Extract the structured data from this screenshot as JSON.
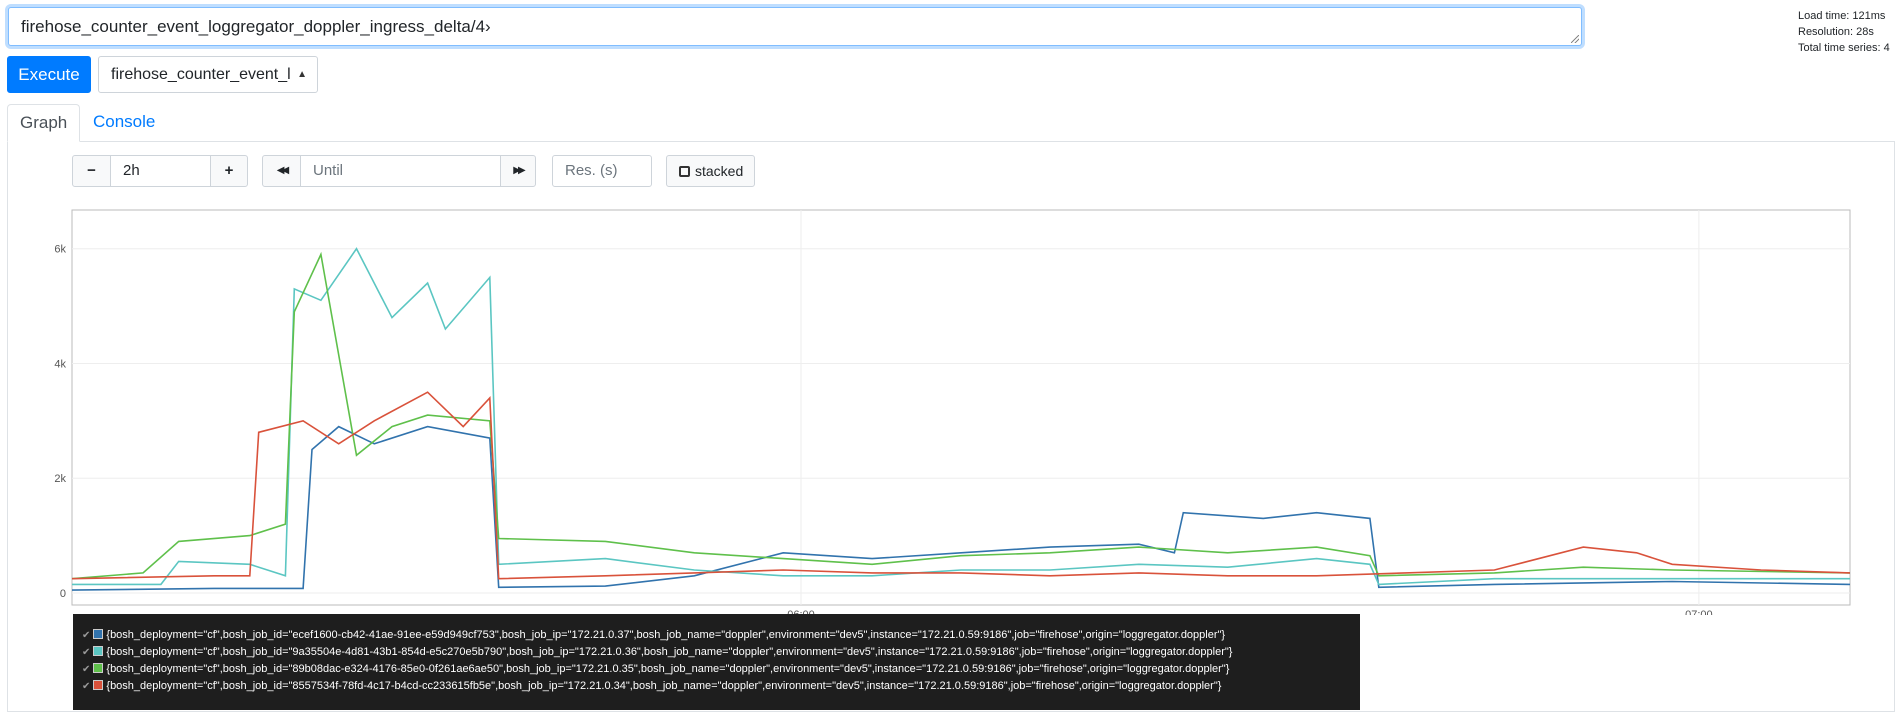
{
  "query": {
    "expression": "firehose_counter_event_loggregator_doppler_ingress_delta/4›",
    "execute_label": "Execute",
    "metric_select_value": "firehose_counter_event_l"
  },
  "stats": {
    "load_time": "Load time: 121ms",
    "resolution": "Resolution: 28s",
    "total_series": "Total time series: 4"
  },
  "tabs": [
    {
      "label": "Graph",
      "active": true
    },
    {
      "label": "Console",
      "active": false
    }
  ],
  "controls": {
    "minus_label": "−",
    "range_value": "2h",
    "plus_label": "+",
    "back_label": "◀◀",
    "until_placeholder": "Until",
    "forward_label": "▶▶",
    "res_placeholder": "Res. (s)",
    "stacked_label": "stacked"
  },
  "chart_data": {
    "type": "line",
    "x_ticks": [
      "06:00",
      "07:00"
    ],
    "y_ticks": [
      "0",
      "2k",
      "4k",
      "6k"
    ],
    "ylim": [
      0,
      6500
    ],
    "grid": true,
    "series": [
      {
        "name": "{bosh_deployment=\"cf\",bosh_job_id=\"ecef1600-cb42-41ae-91ee-e59d949cf753\",bosh_job_ip=\"172.21.0.37\",bosh_job_name=\"doppler\",environment=\"dev5\",instance=\"172.21.0.59:9186\",job=\"firehose\",origin=\"loggregator.doppler\"}",
        "color": "#3173ad",
        "values": [
          [
            0,
            50
          ],
          [
            0.08,
            80
          ],
          [
            0.13,
            80
          ],
          [
            0.135,
            2500
          ],
          [
            0.15,
            2900
          ],
          [
            0.17,
            2600
          ],
          [
            0.2,
            2900
          ],
          [
            0.235,
            2700
          ],
          [
            0.24,
            100
          ],
          [
            0.3,
            120
          ],
          [
            0.35,
            300
          ],
          [
            0.4,
            700
          ],
          [
            0.45,
            600
          ],
          [
            0.5,
            700
          ],
          [
            0.55,
            800
          ],
          [
            0.6,
            850
          ],
          [
            0.62,
            700
          ],
          [
            0.625,
            1400
          ],
          [
            0.67,
            1300
          ],
          [
            0.7,
            1400
          ],
          [
            0.73,
            1300
          ],
          [
            0.735,
            100
          ],
          [
            0.8,
            150
          ],
          [
            0.9,
            200
          ],
          [
            1,
            150
          ]
        ]
      },
      {
        "name": "{bosh_deployment=\"cf\",bosh_job_id=\"9a35504e-4d81-43b1-854d-e5c270e5b790\",bosh_job_ip=\"172.21.0.36\",bosh_job_name=\"doppler\",environment=\"dev5\",instance=\"172.21.0.59:9186\",job=\"firehose\",origin=\"loggregator.doppler\"}",
        "color": "#5bc6c2",
        "values": [
          [
            0,
            150
          ],
          [
            0.05,
            150
          ],
          [
            0.06,
            550
          ],
          [
            0.1,
            500
          ],
          [
            0.12,
            300
          ],
          [
            0.125,
            5300
          ],
          [
            0.14,
            5100
          ],
          [
            0.16,
            6000
          ],
          [
            0.18,
            4800
          ],
          [
            0.2,
            5400
          ],
          [
            0.21,
            4600
          ],
          [
            0.235,
            5500
          ],
          [
            0.24,
            500
          ],
          [
            0.3,
            600
          ],
          [
            0.35,
            400
          ],
          [
            0.4,
            300
          ],
          [
            0.45,
            300
          ],
          [
            0.5,
            400
          ],
          [
            0.55,
            400
          ],
          [
            0.6,
            500
          ],
          [
            0.65,
            450
          ],
          [
            0.7,
            600
          ],
          [
            0.73,
            500
          ],
          [
            0.735,
            150
          ],
          [
            0.8,
            250
          ],
          [
            0.9,
            250
          ],
          [
            1,
            250
          ]
        ]
      },
      {
        "name": "{bosh_deployment=\"cf\",bosh_job_id=\"89b08dac-e324-4176-85e0-0f261ae6ae50\",bosh_job_ip=\"172.21.0.35\",bosh_job_name=\"doppler\",environment=\"dev5\",instance=\"172.21.0.59:9186\",job=\"firehose\",origin=\"loggregator.doppler\"}",
        "color": "#5fc04b",
        "values": [
          [
            0,
            250
          ],
          [
            0.04,
            350
          ],
          [
            0.06,
            900
          ],
          [
            0.1,
            1000
          ],
          [
            0.12,
            1200
          ],
          [
            0.125,
            4900
          ],
          [
            0.14,
            5900
          ],
          [
            0.16,
            2400
          ],
          [
            0.18,
            2900
          ],
          [
            0.2,
            3100
          ],
          [
            0.235,
            3000
          ],
          [
            0.24,
            950
          ],
          [
            0.3,
            900
          ],
          [
            0.35,
            700
          ],
          [
            0.4,
            600
          ],
          [
            0.45,
            500
          ],
          [
            0.5,
            650
          ],
          [
            0.55,
            700
          ],
          [
            0.6,
            800
          ],
          [
            0.65,
            700
          ],
          [
            0.7,
            800
          ],
          [
            0.73,
            650
          ],
          [
            0.735,
            300
          ],
          [
            0.8,
            350
          ],
          [
            0.85,
            450
          ],
          [
            0.9,
            400
          ],
          [
            1,
            350
          ]
        ]
      },
      {
        "name": "{bosh_deployment=\"cf\",bosh_job_id=\"8557534f-78fd-4c17-b4cd-cc233615fb5e\",bosh_job_ip=\"172.21.0.34\",bosh_job_name=\"doppler\",environment=\"dev5\",instance=\"172.21.0.59:9186\",job=\"firehose\",origin=\"loggregator.doppler\"}",
        "color": "#d9523b",
        "values": [
          [
            0,
            250
          ],
          [
            0.08,
            300
          ],
          [
            0.1,
            300
          ],
          [
            0.105,
            2800
          ],
          [
            0.13,
            3000
          ],
          [
            0.15,
            2600
          ],
          [
            0.17,
            3000
          ],
          [
            0.2,
            3500
          ],
          [
            0.22,
            2900
          ],
          [
            0.235,
            3400
          ],
          [
            0.24,
            250
          ],
          [
            0.3,
            300
          ],
          [
            0.35,
            350
          ],
          [
            0.4,
            400
          ],
          [
            0.45,
            350
          ],
          [
            0.5,
            350
          ],
          [
            0.55,
            300
          ],
          [
            0.6,
            350
          ],
          [
            0.65,
            300
          ],
          [
            0.7,
            300
          ],
          [
            0.75,
            350
          ],
          [
            0.8,
            400
          ],
          [
            0.85,
            800
          ],
          [
            0.88,
            700
          ],
          [
            0.9,
            500
          ],
          [
            0.95,
            400
          ],
          [
            1,
            350
          ]
        ]
      }
    ]
  }
}
